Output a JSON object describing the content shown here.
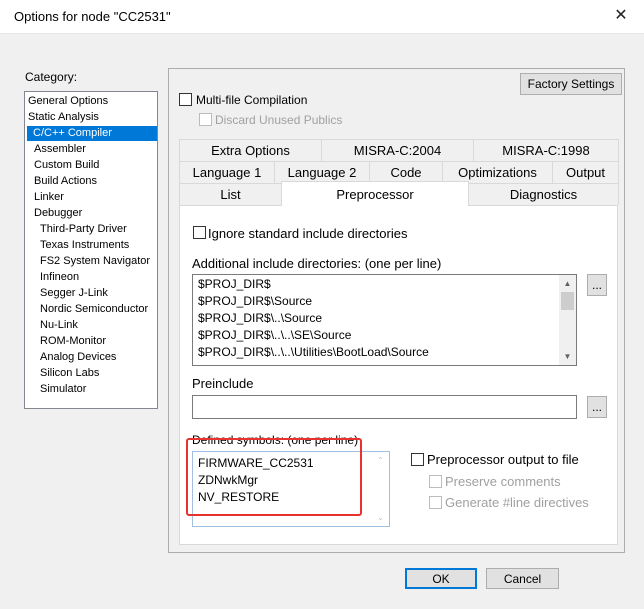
{
  "window": {
    "title": "Options for node \"CC2531\"",
    "close_glyph": "✕"
  },
  "category": {
    "label": "Category:",
    "items": [
      "General Options",
      "Static Analysis",
      "C/C++ Compiler",
      "Assembler",
      "Custom Build",
      "Build Actions",
      "Linker",
      "Debugger",
      "Third-Party Driver",
      "Texas Instruments",
      "FS2 System Navigator",
      "Infineon",
      "Segger J-Link",
      "Nordic Semiconductor",
      "Nu-Link",
      "ROM-Monitor",
      "Analog Devices",
      "Silicon Labs",
      "Simulator"
    ],
    "selected": "C/C++ Compiler"
  },
  "buttons": {
    "factory_settings": "Factory Settings",
    "ok": "OK",
    "cancel": "Cancel",
    "browse": "..."
  },
  "options": {
    "multi_file": "Multi-file Compilation",
    "discard_unused": "Discard Unused Publics"
  },
  "tabs": {
    "row1": [
      "Extra Options",
      "MISRA-C:2004",
      "MISRA-C:1998"
    ],
    "row2": [
      "Language 1",
      "Language 2",
      "Code",
      "Optimizations",
      "Output"
    ],
    "row3": [
      "List",
      "Preprocessor",
      "Diagnostics"
    ],
    "active": "Preprocessor"
  },
  "preprocessor": {
    "ignore_std": "Ignore standard include directories",
    "include_dirs_label": "Additional include directories: (one per line)",
    "include_dirs": [
      "$PROJ_DIR$",
      "$PROJ_DIR$\\Source",
      "$PROJ_DIR$\\..\\Source",
      "$PROJ_DIR$\\..\\..\\SE\\Source",
      "$PROJ_DIR$\\..\\..\\Utilities\\BootLoad\\Source"
    ],
    "preinclude_label": "Preinclude",
    "preinclude_value": "",
    "defined_symbols_label": "Defined symbols: (one per line)",
    "defined_symbols": [
      "FIRMWARE_CC2531",
      "ZDNwkMgr",
      "NV_RESTORE"
    ],
    "preprocessor_output": "Preprocessor output to file",
    "preserve_comments": "Preserve comments",
    "generate_line": "Generate #line directives"
  },
  "colors": {
    "selection": "#0078d7",
    "annotation": "#e8322e"
  },
  "icons": {
    "close": "close-icon",
    "scroll_up": "chevron-up-icon",
    "scroll_down": "chevron-down-icon"
  }
}
